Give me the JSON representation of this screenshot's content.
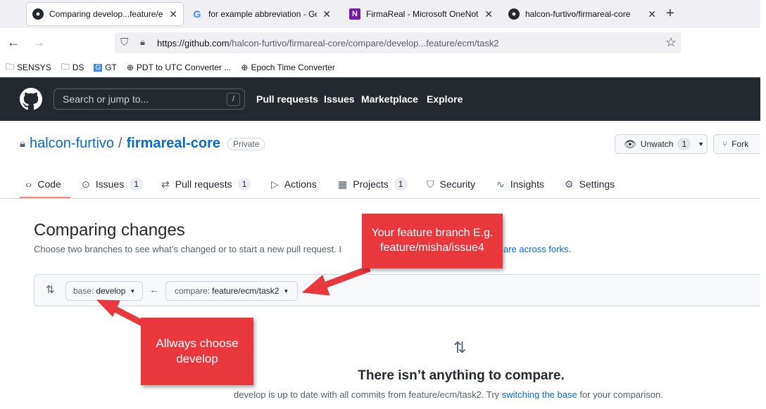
{
  "browser": {
    "tabs": [
      {
        "title": "Comparing develop...feature/ec",
        "icon": "github-icon",
        "active": true
      },
      {
        "title": "for example abbreviation - Goo",
        "icon": "google-icon",
        "active": false
      },
      {
        "title": "FirmaReal - Microsoft OneNote",
        "icon": "onenote-icon",
        "active": false
      },
      {
        "title": "halcon-furtivo/firmareal-core",
        "icon": "github-icon",
        "active": false
      }
    ],
    "new_tab": "+",
    "close": "✕",
    "url_host": "https://github.com",
    "url_path": "/halcon-furtivo/firmareal-core/compare/develop...feature/ecm/task2",
    "bookmarks": [
      "SENSYS",
      "DS",
      "GT",
      "PDT to UTC Converter ...",
      "Epoch Time Converter"
    ]
  },
  "github": {
    "search_placeholder": "Search or jump to...",
    "search_key": "/",
    "nav": [
      "Pull requests",
      "Issues",
      "Marketplace",
      "Explore"
    ]
  },
  "repo": {
    "owner": "halcon-furtivo",
    "sep": "/",
    "name": "firmareal-core",
    "visibility": "Private",
    "unwatch_label": "Unwatch",
    "watch_count": "1",
    "fork_label": "Fork",
    "tabs": [
      {
        "label": "Code",
        "icon": "code-icon",
        "count": null
      },
      {
        "label": "Issues",
        "icon": "issue-icon",
        "count": "1"
      },
      {
        "label": "Pull requests",
        "icon": "pull-request-icon",
        "count": "1"
      },
      {
        "label": "Actions",
        "icon": "play-icon",
        "count": null
      },
      {
        "label": "Projects",
        "icon": "table-icon",
        "count": "1"
      },
      {
        "label": "Security",
        "icon": "shield-icon",
        "count": null
      },
      {
        "label": "Insights",
        "icon": "graph-icon",
        "count": null
      },
      {
        "label": "Settings",
        "icon": "gear-icon",
        "count": null
      }
    ]
  },
  "compare": {
    "title": "Comparing changes",
    "description_pre": "Choose two branches to see what’s changed or to start a new pull request. I",
    "description_link": "are across forks",
    "description_post": ".",
    "base_prefix": "base:",
    "base_value": "develop",
    "compare_prefix": "compare:",
    "compare_value": "feature/ecm/task2",
    "empty_title": "There isn’t anything to compare.",
    "empty_desc_pre": "develop is up to date with all commits from feature/ecm/task2. Try ",
    "empty_desc_link": "switching the base",
    "empty_desc_post": " for your comparison."
  },
  "annotations": {
    "feature_note": "Your feature branch E.g. feature/misha/issue4",
    "develop_note": "Allways choose develop"
  },
  "colors": {
    "accent": "#0969da",
    "header": "#24292f",
    "annotation": "#e8373d",
    "active_tab_border": "#fd8c73"
  }
}
